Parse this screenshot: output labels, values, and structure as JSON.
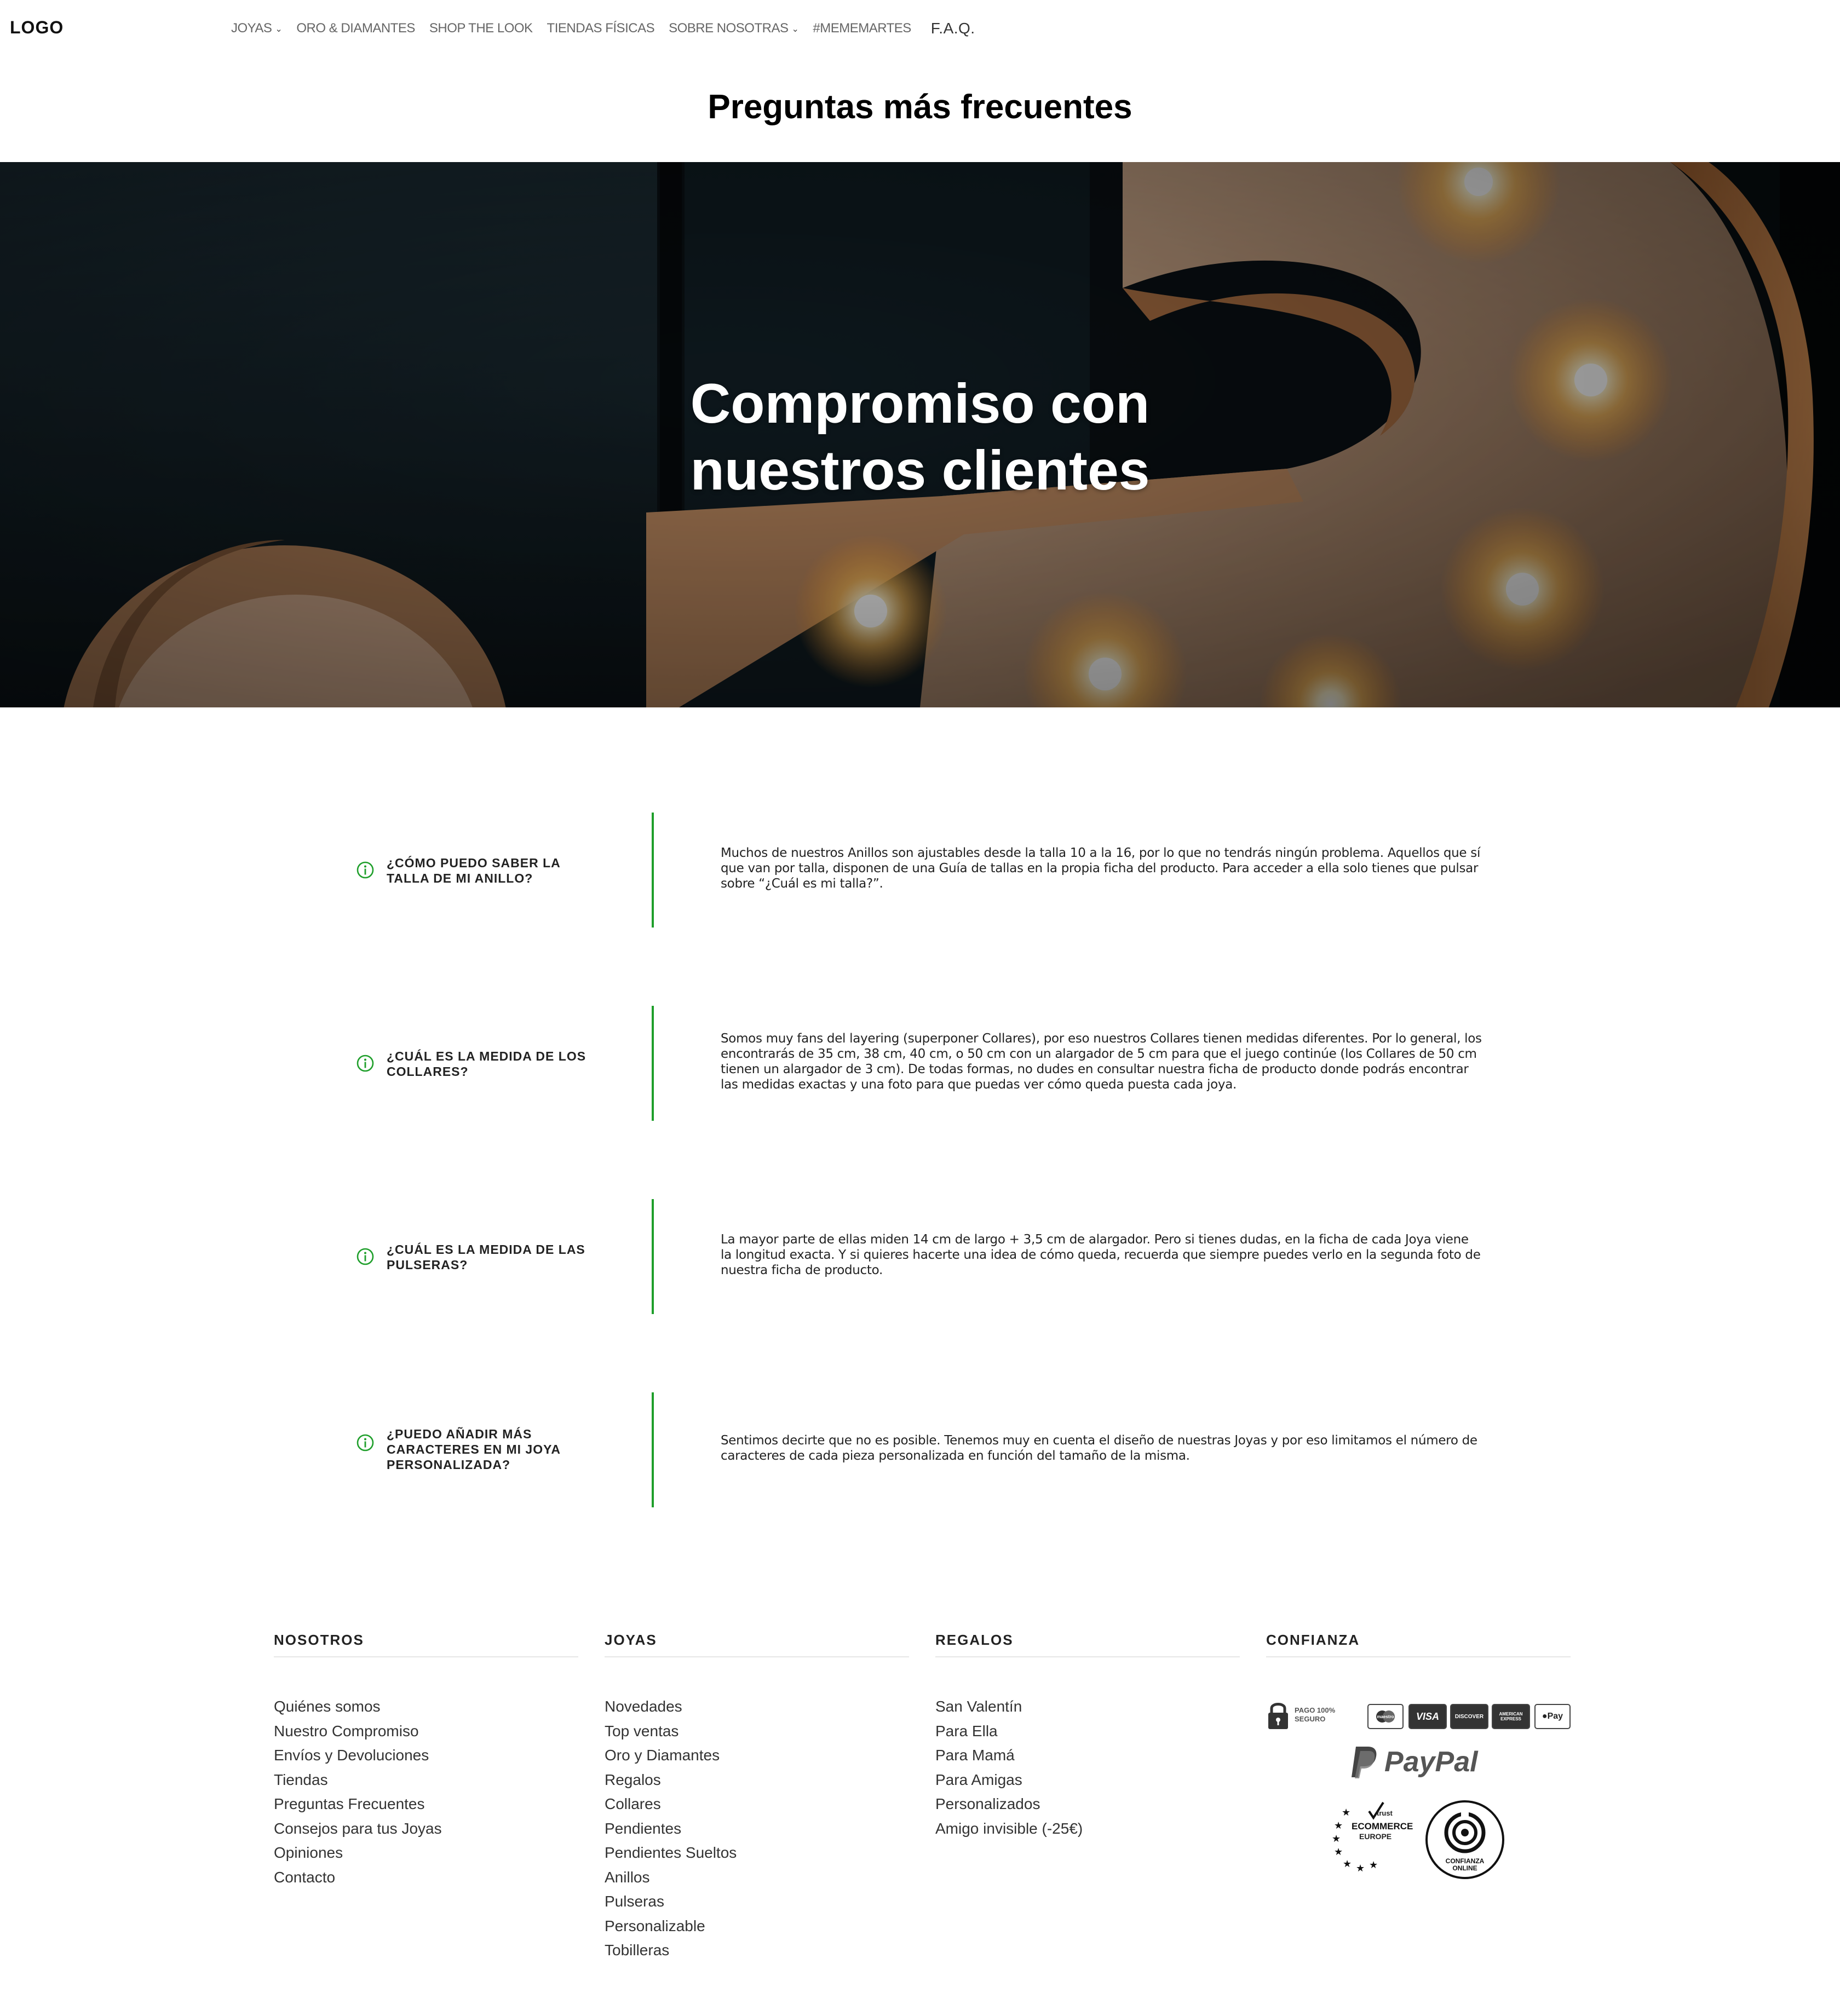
{
  "nav": {
    "logo": "LOGO",
    "items": [
      {
        "label": "JOYAS",
        "dropdown": true
      },
      {
        "label": "ORO & DIAMANTES",
        "dropdown": false
      },
      {
        "label": "SHOP THE LOOK",
        "dropdown": false
      },
      {
        "label": "TIENDAS FÍSICAS",
        "dropdown": false
      },
      {
        "label": "SOBRE NOSOTRAS",
        "dropdown": true
      },
      {
        "label": "#MEMEMARTES",
        "dropdown": false
      }
    ],
    "active_item": "F.A.Q.",
    "chevron_icon": "chevron-down-icon"
  },
  "page": {
    "title": "Preguntas más frecuentes"
  },
  "hero": {
    "line1": "Compromiso con",
    "line2": "nuestros clientes",
    "image_subject": "marquee-letter-lights"
  },
  "faq": [
    {
      "question": "¿Cómo puedo saber la talla de mi anillo?",
      "answer": "Muchos de nuestros Anillos son ajustables desde la talla 10 a la 16, por lo que no tendrás ningún problema. Aquellos que sí que van por talla, disponen de una Guía de tallas en la propia ficha del producto. Para acceder a ella solo tienes que pulsar sobre “¿Cuál es mi talla?”."
    },
    {
      "question": "¿Cuál es la medida de los collares?",
      "answer": "Somos muy fans del layering (superponer Collares), por eso nuestros Collares tienen medidas diferentes. Por lo general, los encontrarás de 35 cm, 38 cm, 40 cm, o 50 cm  con un alargador de 5 cm para que el juego continúe (los Collares de 50 cm tienen un alargador de 3 cm). De todas formas, no dudes en consultar nuestra ficha de producto donde podrás encontrar las medidas exactas y una foto para que puedas ver cómo queda puesta cada joya."
    },
    {
      "question": "¿Cuál es la medida de las pulseras?",
      "answer": "La mayor parte de ellas miden 14 cm de largo + 3,5 cm de alargador. Pero si tienes dudas, en la ficha de cada Joya viene la longitud exacta. Y si quieres hacerte una idea de cómo queda, recuerda que siempre puedes verlo en la segunda foto de nuestra ficha de producto."
    },
    {
      "question": "¿Puedo añadir más caracteres en mi joya personalizada?",
      "answer": "Sentimos decirte que no es posible. Tenemos muy en cuenta el diseño de nuestras Joyas y por eso limitamos el número de caracteres de cada pieza personalizada en función del tamaño de la misma."
    }
  ],
  "faq_icon": "info-circle-icon",
  "faq_accent_color": "#1f9f2b",
  "footer": {
    "nosotros": {
      "heading": "NOSOTROS",
      "links": [
        "Quiénes somos",
        "Nuestro Compromiso",
        "Envíos y Devoluciones",
        "Tiendas",
        "Preguntas Frecuentes",
        "Consejos para tus Joyas",
        "Opiniones",
        "Contacto"
      ]
    },
    "joyas": {
      "heading": "JOYAS",
      "links": [
        "Novedades",
        "Top ventas",
        "Oro y Diamantes",
        "Regalos",
        "Collares",
        "Pendientes",
        "Pendientes Sueltos",
        "Anillos",
        "Pulseras",
        "Personalizable",
        "Tobilleras"
      ]
    },
    "regalos": {
      "heading": "REGALOS",
      "links": [
        "San Valentín",
        "Para Ella",
        "Para Mamá",
        "Para Amigas",
        "Personalizados",
        "Amigo invisible (-25€)"
      ]
    },
    "confianza": {
      "heading": "CONFIANZA",
      "secure_line1": "PAGO 100%",
      "secure_line2": "SEGURO",
      "cards": [
        "maestro",
        "VISA",
        "DISCOVER",
        "AMERICAN EXPRESS",
        "Pay"
      ],
      "paypal": "PayPal",
      "trusted_line1": "trust",
      "trusted_line2": "ECOMMERCE",
      "trusted_line3": "EUROPE",
      "confianza_online_line1": "CONFIANZA",
      "confianza_online_line2": "ONLINE"
    }
  }
}
